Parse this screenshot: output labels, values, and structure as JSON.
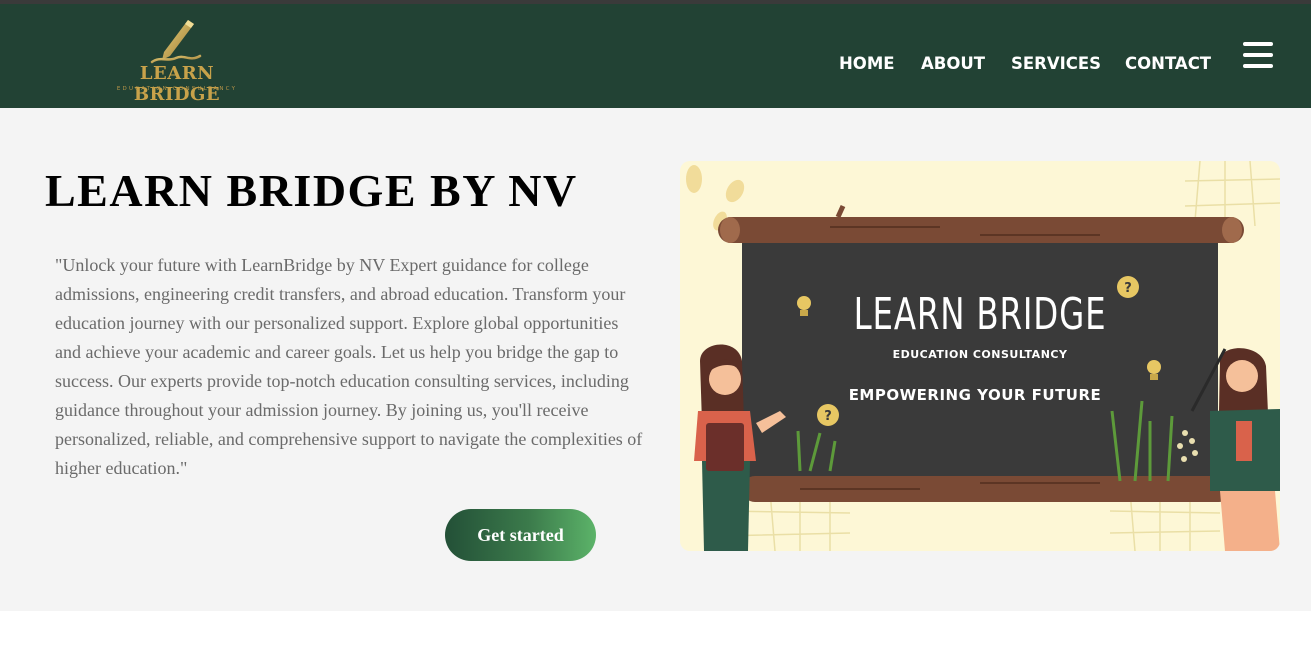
{
  "brand": {
    "name": "LEARN BRIDGE",
    "tagline": "EDUCATION CONSULTANCY"
  },
  "nav": {
    "items": [
      "HOME",
      "ABOUT",
      "SERVICES",
      "CONTACT"
    ],
    "menu_icon": "hamburger-menu-icon"
  },
  "hero": {
    "title": "LEARN BRIDGE BY NV",
    "description": "\"Unlock your future with LearnBridge by NV Expert guidance for college admissions, engineering credit transfers, and abroad education. Transform your education journey with our personalized support. Explore global opportunities and achieve your academic and career goals. Let us help you bridge the gap to success. Our experts provide top-notch education consulting services, including guidance throughout your admission journey. By joining us, you'll receive personalized, reliable, and comprehensive support to navigate the complexities of higher education.\"",
    "cta_label": "Get started"
  },
  "banner": {
    "title": "LEARN BRIDGE",
    "subtitle": "EDUCATION CONSULTANCY",
    "tagline": "EMPOWERING YOUR FUTURE"
  },
  "colors": {
    "navbar": "#224234",
    "hero_bg": "#f4f4f4",
    "gold": "#c8a24a",
    "board": "#3a3a3a",
    "wood": "#7a4a35"
  }
}
